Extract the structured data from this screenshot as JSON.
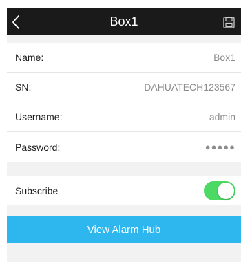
{
  "header": {
    "title": "Box1",
    "back_icon": "chevron-left-icon",
    "save_icon": "save-icon"
  },
  "info": {
    "name_label": "Name:",
    "name_value": "Box1",
    "sn_label": "SN:",
    "sn_value": "DAHUATECH123567",
    "username_label": "Username:",
    "username_value": "admin",
    "password_label": "Password:",
    "password_value": "●●●●●"
  },
  "subscribe": {
    "label": "Subscribe",
    "enabled": true
  },
  "actions": {
    "view_alarm_hub_label": "View Alarm Hub"
  },
  "colors": {
    "topbar": "#1a1a1a",
    "toggle_on": "#4cd964",
    "accent_button": "#2eb7ef",
    "background": "#f2f2f2"
  }
}
